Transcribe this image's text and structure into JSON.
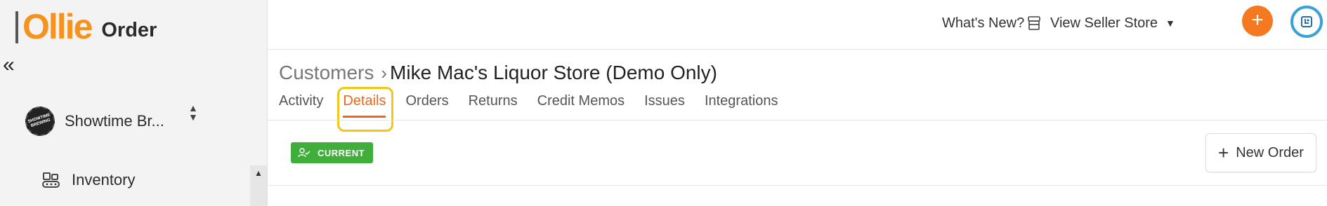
{
  "brand": {
    "logo_word": "Ollie",
    "product": "Order",
    "logo_color": "#f6921e"
  },
  "sidebar": {
    "collapse_glyph": "«",
    "store": {
      "name": "Showtime Br...",
      "avatar_text": "SHOWTIME BREWING"
    },
    "items": [
      {
        "label": "Inventory",
        "icon": "inventory-icon"
      }
    ]
  },
  "topbar": {
    "whats_new": "What's New?",
    "view_seller_store": "View Seller Store",
    "add_glyph": "+",
    "accent_color": "#f47920"
  },
  "breadcrumb": {
    "parent": "Customers",
    "separator": "›",
    "current": "Mike Mac's Liquor Store (Demo Only)"
  },
  "tabs": [
    {
      "label": "Activity",
      "active": false
    },
    {
      "label": "Details",
      "active": true
    },
    {
      "label": "Orders",
      "active": false
    },
    {
      "label": "Returns",
      "active": false
    },
    {
      "label": "Credit Memos",
      "active": false
    },
    {
      "label": "Issues",
      "active": false
    },
    {
      "label": "Integrations",
      "active": false
    }
  ],
  "status": {
    "label": "CURRENT",
    "color": "#3fae3a"
  },
  "actions": {
    "new_order": "New Order",
    "plus_glyph": "+"
  }
}
